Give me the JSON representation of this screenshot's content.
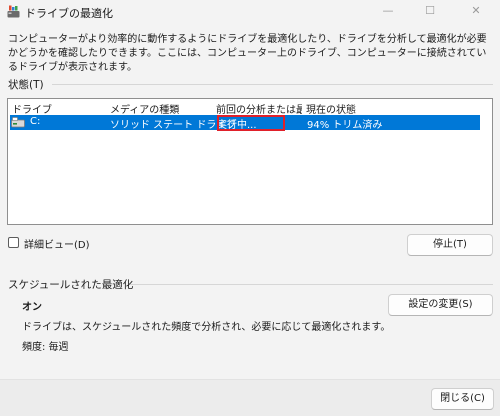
{
  "window": {
    "title": "ドライブの最適化",
    "controls": {
      "minimize": "—",
      "maximize": "☐",
      "close": "✕"
    }
  },
  "description": "コンピューターがより効率的に動作するようにドライブを最適化したり、ドライブを分析して最適化が必要かどうかを確認したりできます。ここには、コンピューター上のドライブ、コンピューターに接続されているドライブが表示されます。",
  "status": {
    "header": "状態(T)",
    "columns": [
      "ドライブ",
      "メディアの種類",
      "前回の分析または最...",
      "現在の状態"
    ],
    "rows": [
      {
        "drive": "C:",
        "media": "ソリッド ステート ドライブ",
        "last_run": "実行中...",
        "status": "94% トリム済み",
        "selected": true
      }
    ],
    "details_checkbox": {
      "label": "詳細ビュー(D)",
      "checked": false
    },
    "stop_button": "停止(T)"
  },
  "schedule": {
    "header": "スケジュールされた最適化",
    "state": "オン",
    "info": "ドライブは、スケジュールされた頻度で分析され、必要に応じて最適化されます。",
    "frequency": "頻度: 毎週",
    "change_settings_button": "設定の変更(S)"
  },
  "footer": {
    "close_button": "閉じる(C)"
  },
  "colors": {
    "selection": "#0078d7",
    "highlight_border": "#e0202a"
  },
  "icons": {
    "app": "defrag-app-icon",
    "drive": "drive-icon"
  }
}
